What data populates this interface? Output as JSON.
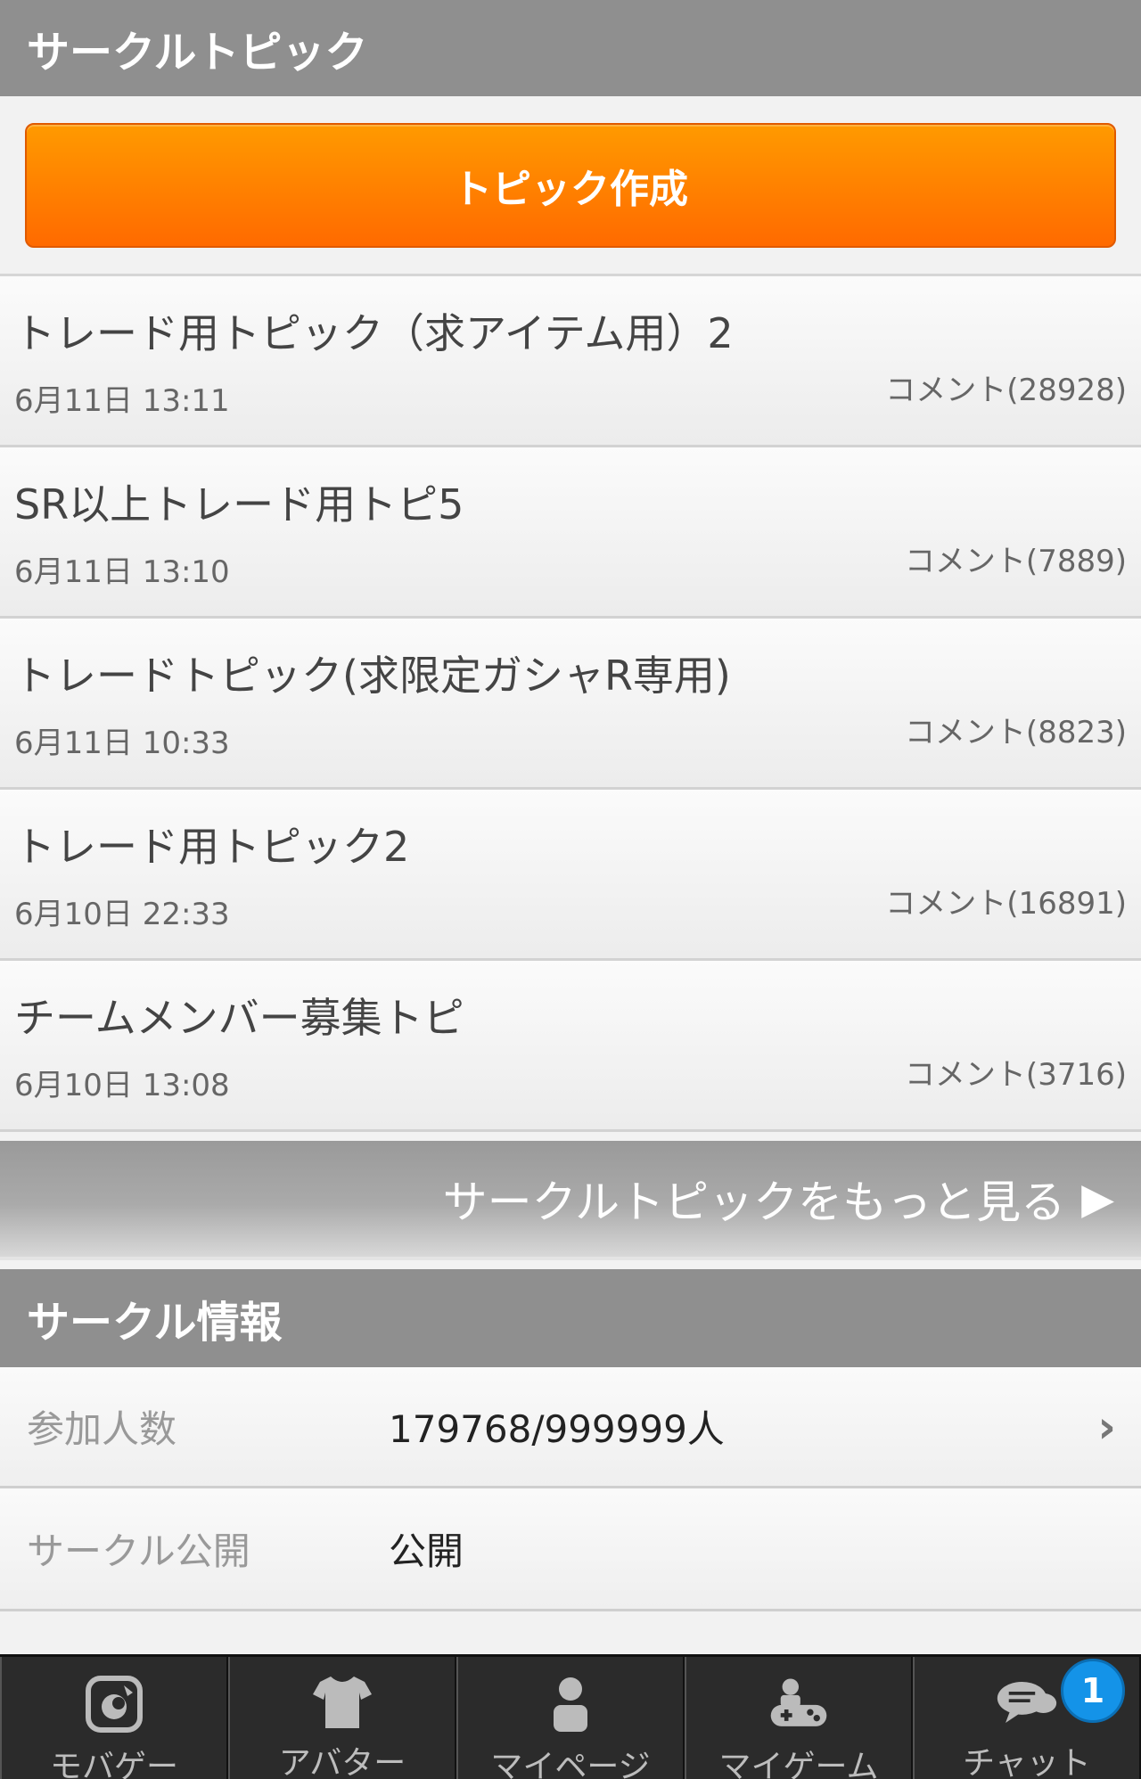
{
  "topics_section": {
    "title": "サークルトピック",
    "create_button": "トピック作成",
    "items": [
      {
        "title": "トレード用トピック（求アイテム用）2",
        "date": "6月11日 13:11",
        "comments": "コメント(28928)"
      },
      {
        "title": "SR以上トレード用トピ5",
        "date": "6月11日 13:10",
        "comments": "コメント(7889)"
      },
      {
        "title": "トレードトピック(求限定ガシャR専用)",
        "date": "6月11日 10:33",
        "comments": "コメント(8823)"
      },
      {
        "title": "トレード用トピック2",
        "date": "6月10日 22:33",
        "comments": "コメント(16891)"
      },
      {
        "title": "チームメンバー募集トピ",
        "date": "6月10日 13:08",
        "comments": "コメント(3716)"
      }
    ],
    "more_link": "サークルトピックをもっと見る",
    "more_arrow": "▶"
  },
  "info_section": {
    "title": "サークル情報",
    "rows": [
      {
        "label": "参加人数",
        "value": "179768/999999人",
        "chevron": "›"
      },
      {
        "label": "サークル公開",
        "value": "公開"
      }
    ]
  },
  "bottom_nav": {
    "items": [
      {
        "label": "モバゲー",
        "icon": "mobage-icon"
      },
      {
        "label": "アバター",
        "icon": "tshirt-icon"
      },
      {
        "label": "マイページ",
        "icon": "person-icon"
      },
      {
        "label": "マイゲーム",
        "icon": "gamepad-icon"
      },
      {
        "label": "チャット",
        "icon": "chat-icon",
        "badge": "1"
      }
    ]
  },
  "colors": {
    "header_bg": "#8f8f8f",
    "create_button": "#ff7a00",
    "nav_bg": "#2b2b2b",
    "badge": "#1493e8"
  }
}
